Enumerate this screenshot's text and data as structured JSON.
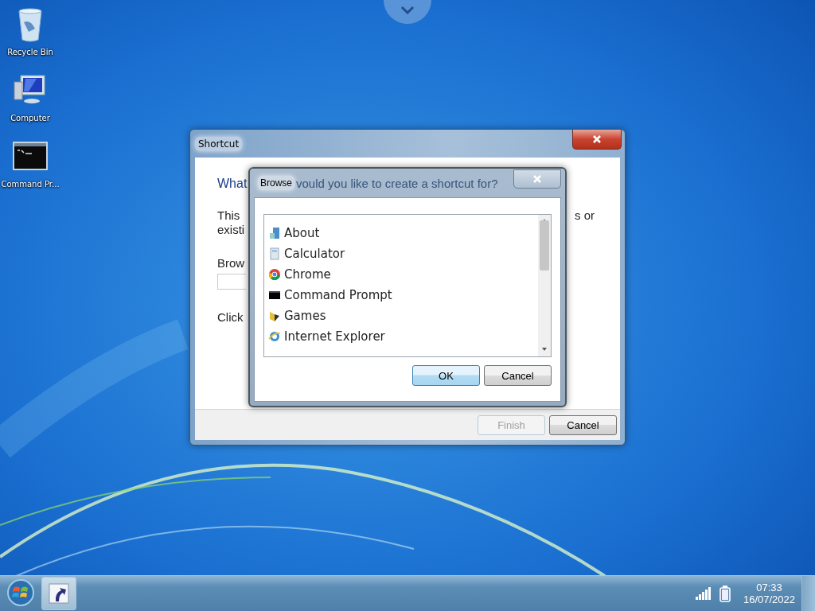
{
  "desktop_icons": [
    {
      "label": "Recycle Bin",
      "kind": "recycle"
    },
    {
      "label": "Computer",
      "kind": "computer"
    },
    {
      "label": "Command Pr...",
      "kind": "console"
    }
  ],
  "wizard": {
    "title": "Shortcut",
    "heading": "What",
    "line_1_start": "This",
    "line_1_end": "s or",
    "line_2_start": "existi",
    "browse_label": "Brow",
    "click_text": "Click",
    "buttons": [
      {
        "label": "Finish",
        "disabled": true
      },
      {
        "label": "Cancel",
        "disabled": false
      }
    ]
  },
  "browse_dialog": {
    "title": "Browse",
    "title_showthrough": "vould you like to create a shortcut for?",
    "items": [
      {
        "label": "About",
        "kind": "about"
      },
      {
        "label": "Calculator",
        "kind": "calculator"
      },
      {
        "label": "Chrome",
        "kind": "chrome"
      },
      {
        "label": "Command Prompt",
        "kind": "console"
      },
      {
        "label": "Games",
        "kind": "games"
      },
      {
        "label": "Internet Explorer",
        "kind": "ie"
      }
    ],
    "buttons": [
      {
        "label": "OK",
        "default": true
      },
      {
        "label": "Cancel",
        "default": false
      }
    ]
  },
  "taskbar": {
    "time": "07:33",
    "date": "16/07/2022"
  }
}
